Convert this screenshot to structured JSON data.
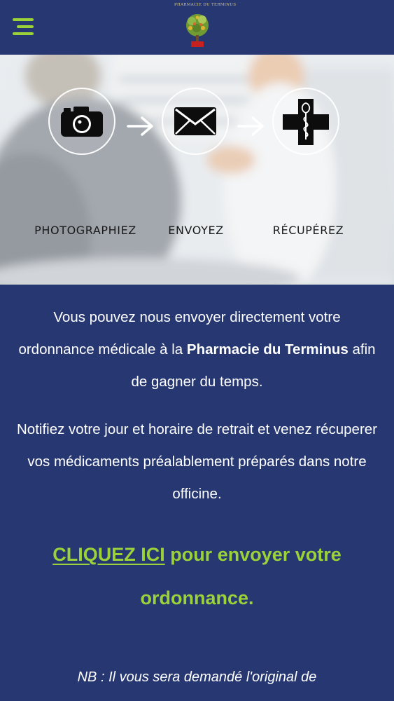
{
  "header": {
    "menu_icon": "hamburger-menu-icon",
    "logo_text": "Pharmacie du Terminus",
    "logo_icon": "tree-logo-icon",
    "accent_color": "#9bd139",
    "background_color": "#263772"
  },
  "hero": {
    "steps": [
      {
        "label": "PHOTOGRAPHIEZ",
        "icon": "camera-icon"
      },
      {
        "label": "ENVOYEZ",
        "icon": "envelope-icon"
      },
      {
        "label": "RÉCUPÉREZ",
        "icon": "pharmacy-cross-icon"
      }
    ],
    "arrow_icon": "arrow-right-icon"
  },
  "content": {
    "intro_before": "Vous pouvez nous envoyer directement votre ordonnance médicale à la ",
    "intro_bold": "Pharmacie du Terminus",
    "intro_after": " afin de gagner du temps.",
    "notify": "Notifiez votre jour et horaire de retrait et venez récuperer vos médicaments préalablement préparés dans notre officine.",
    "cta_link": "CLIQUEZ ICI",
    "cta_rest": " pour envoyer votre ordonnance.",
    "nb": "NB : Il vous sera demandé l'original de"
  }
}
